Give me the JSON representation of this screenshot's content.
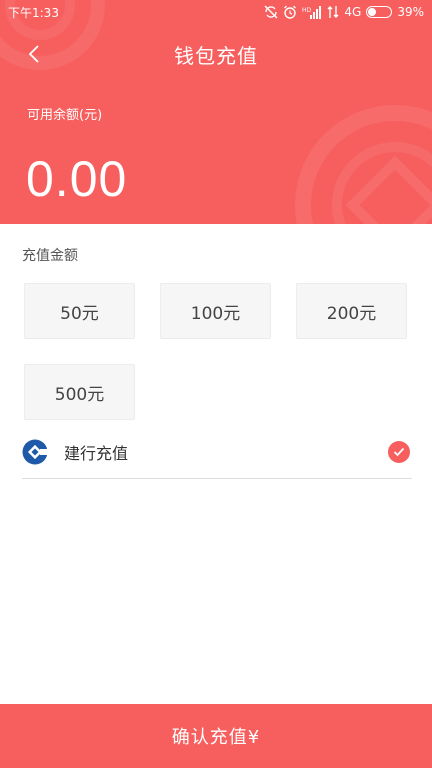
{
  "status_bar": {
    "time": "下午1:33",
    "network": "4G",
    "battery_percent": "39%",
    "battery_level": 0.39
  },
  "nav": {
    "title": "钱包充值"
  },
  "balance": {
    "label": "可用余额(元)",
    "value": "0.00"
  },
  "recharge": {
    "section_label": "充值金额",
    "amounts": [
      "50元",
      "100元",
      "200元",
      "500元"
    ]
  },
  "payment": {
    "method_label": "建行充值",
    "selected": true
  },
  "confirm": {
    "label": "确认充值¥"
  },
  "colors": {
    "primary": "#f75f5f",
    "bank_blue": "#1f5aa8"
  },
  "icons": {
    "back": "chevron-left-icon",
    "check": "check-circle-icon",
    "bank": "ccb-logo-icon"
  }
}
